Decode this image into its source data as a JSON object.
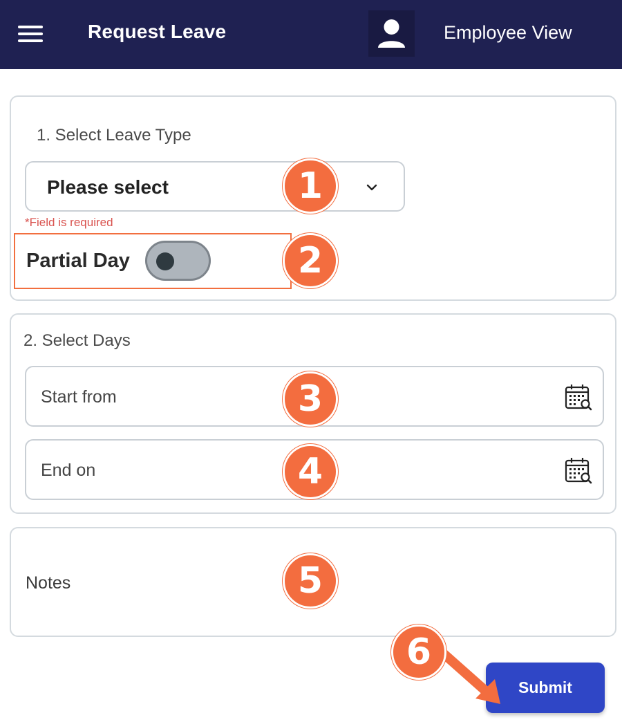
{
  "header": {
    "title": "Request Leave",
    "view_label": "Employee View",
    "background": "#1f2152"
  },
  "leave_type": {
    "section_label": "1. Select Leave Type",
    "select_value": "Please select",
    "required_note": "*Field is required",
    "partial_day_label": "Partial Day",
    "partial_day_on": false
  },
  "days": {
    "section_label": "2. Select Days",
    "start_label": "Start from",
    "end_label": "End on"
  },
  "notes": {
    "label": "Notes"
  },
  "submit_label": "Submit",
  "callouts": [
    "1",
    "2",
    "3",
    "4",
    "5",
    "6"
  ],
  "colors": {
    "callout": "#f36d3f",
    "submit": "#2f46c6",
    "required": "#d9534f"
  }
}
